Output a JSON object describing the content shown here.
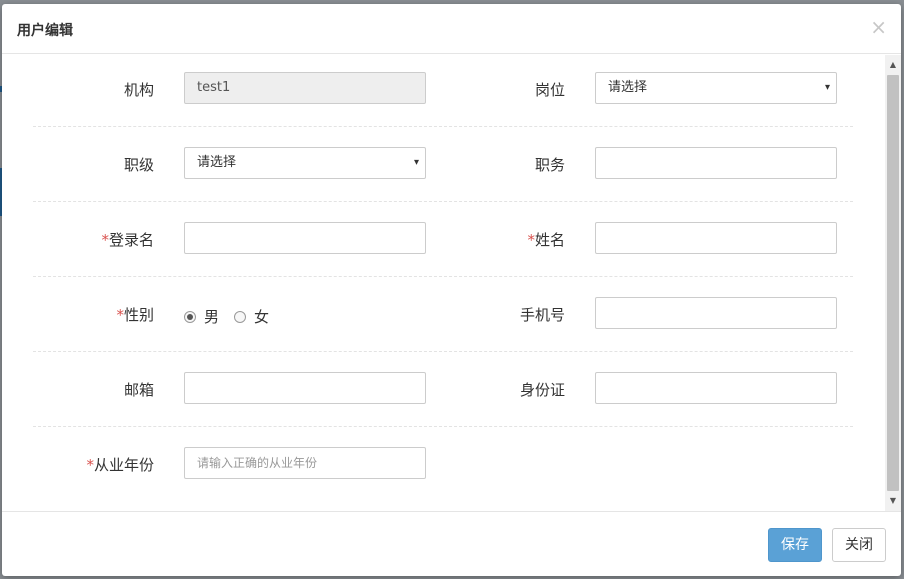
{
  "dialog": {
    "title": "用户编辑",
    "close_glyph": "×"
  },
  "form": {
    "org": {
      "label": "机构",
      "value": "test1"
    },
    "post": {
      "label": "岗位",
      "selected": "请选择"
    },
    "rank": {
      "label": "职级",
      "selected": "请选择"
    },
    "duty": {
      "label": "职务",
      "value": ""
    },
    "login": {
      "required_mark": "*",
      "label": "登录名",
      "value": ""
    },
    "name": {
      "required_mark": "*",
      "label": "姓名",
      "value": ""
    },
    "gender": {
      "required_mark": "*",
      "label": "性别",
      "options": [
        "男",
        "女"
      ],
      "selected": "男"
    },
    "phone": {
      "label": "手机号",
      "value": ""
    },
    "email": {
      "label": "邮箱",
      "value": ""
    },
    "idcard": {
      "label": "身份证",
      "value": ""
    },
    "years": {
      "required_mark": "*",
      "label": "从业年份",
      "placeholder": "请输入正确的从业年份"
    }
  },
  "footer": {
    "save_label": "保存",
    "close_label": "关闭"
  },
  "colors": {
    "primary": "#5aa1d6",
    "required": "#d9534f"
  },
  "icons": {
    "select_arrow": "▾",
    "scroll_up": "▲",
    "scroll_down": "▼"
  }
}
